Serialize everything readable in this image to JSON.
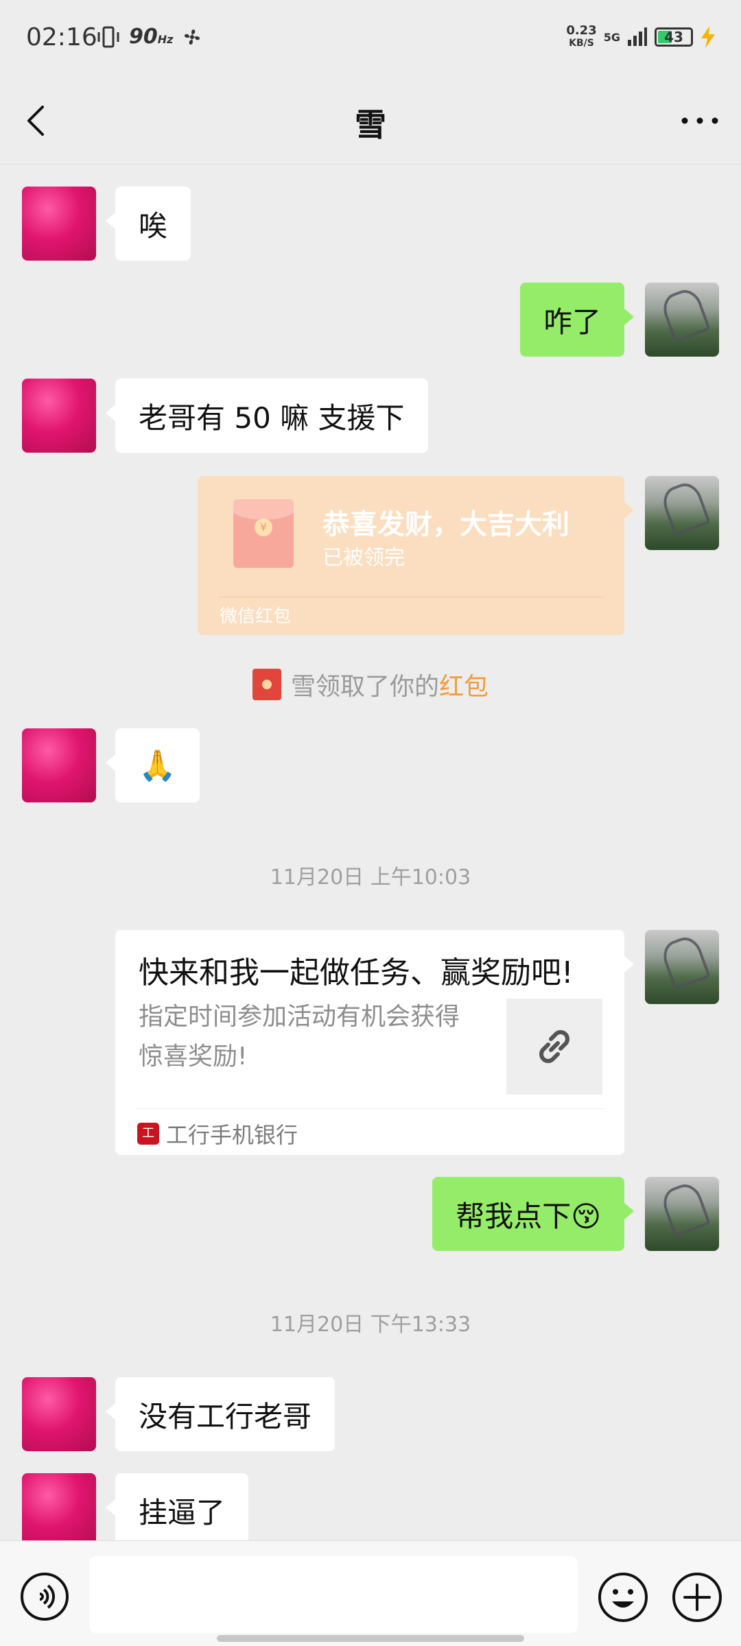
{
  "status_bar": {
    "time": "02:16",
    "refresh_rate": "90",
    "refresh_unit": "Hz",
    "net_speed_value": "0.23",
    "net_speed_unit": "KB/S",
    "network": "5G",
    "battery": "43"
  },
  "header": {
    "title": "雪"
  },
  "messages": [
    {
      "from": "friend",
      "text": "唉"
    },
    {
      "from": "me",
      "text": "咋了"
    },
    {
      "from": "friend",
      "text": "老哥有 50 嘛 支援下"
    },
    {
      "from": "friend",
      "text": "🙏"
    },
    {
      "from": "me",
      "text": "帮我点下😚"
    },
    {
      "from": "friend",
      "text": "没有工行老哥"
    },
    {
      "from": "friend",
      "text": "挂逼了"
    }
  ],
  "red_packet": {
    "title": "恭喜发财，大吉大利",
    "status": "已被领完",
    "footer": "微信红包"
  },
  "system_note": {
    "prefix": "雪领取了你的",
    "highlight": "红包"
  },
  "timestamps": [
    "11月20日 上午10:03",
    "11月20日 下午13:33"
  ],
  "link_card": {
    "title": "快来和我一起做任务、赢奖励吧!",
    "description": "指定时间参加活动有机会获得惊喜奖励!",
    "source": "工行手机银行",
    "source_icon": "icbc-logo-icon",
    "thumb_icon": "link-icon"
  },
  "input_bar": {
    "placeholder": ""
  },
  "colors": {
    "background": "#ededed",
    "my_bubble": "#95ec69",
    "friend_bubble": "#ffffff",
    "red_packet_received": "#fbddbf",
    "accent_orange": "#f29b38"
  }
}
